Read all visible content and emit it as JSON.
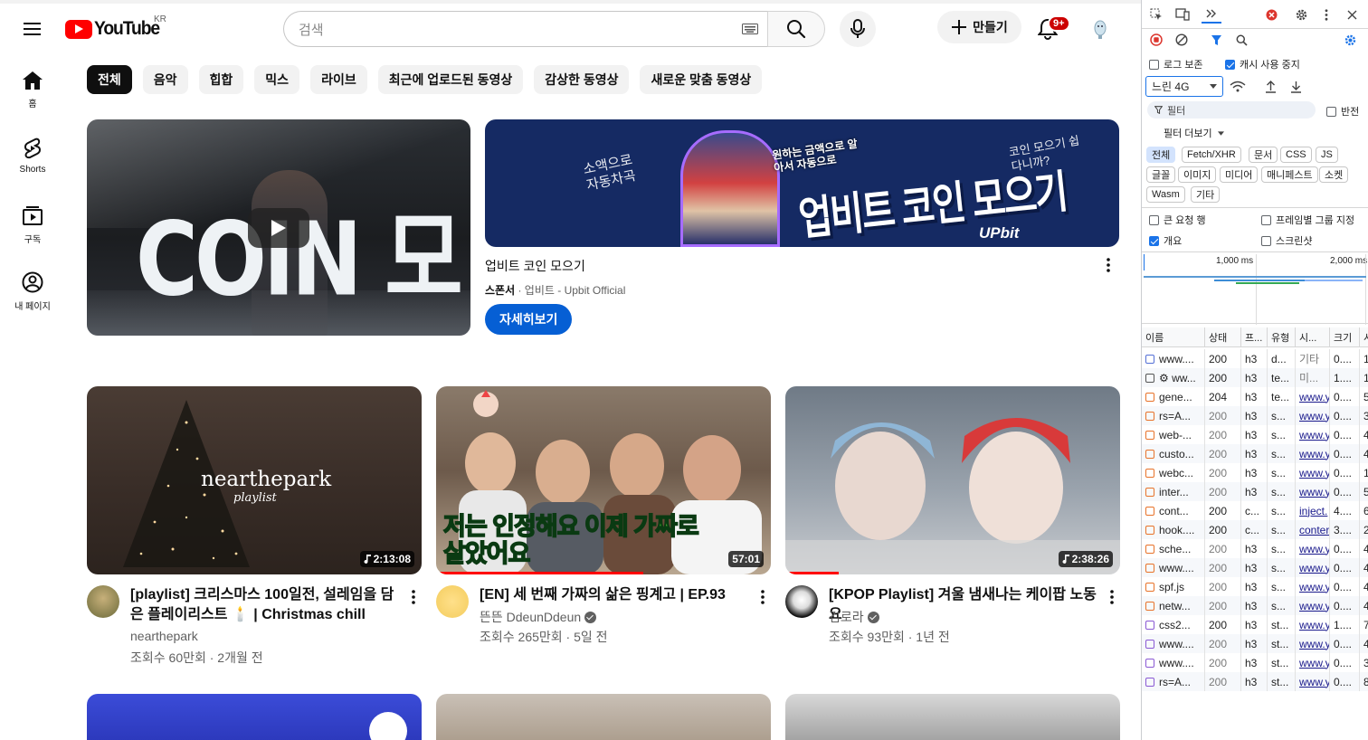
{
  "masthead": {
    "logo_text": "YouTube",
    "country_code": "KR",
    "search_placeholder": "검색",
    "create_label": "만들기",
    "notification_count": "9+"
  },
  "guide": [
    {
      "label": "홈",
      "icon": "home-icon"
    },
    {
      "label": "Shorts",
      "icon": "shorts-icon"
    },
    {
      "label": "구독",
      "icon": "subscriptions-icon"
    },
    {
      "label": "내 페이지",
      "icon": "you-icon"
    }
  ],
  "chips": [
    "전체",
    "음악",
    "힙합",
    "믹스",
    "라이브",
    "최근에 업로드된 동영상",
    "감상한 동영상",
    "새로운 맞춤 동영상"
  ],
  "ad": {
    "video_text": "COIN 모으기",
    "banner_headline": "업비트 코인 모으기",
    "banner_left": "소액으로 자동차곡",
    "banner_sub": "원하는 금액으로 알아서 자동으로",
    "banner_right": "코인 모으기 쉽다니까?",
    "banner_brand": "UPbit",
    "title": "업비트 코인 모으기",
    "sponsor_label": "스폰서",
    "advertiser": "업비트 - Upbit Official",
    "cta": "자세히보기"
  },
  "videos": [
    {
      "title": "[playlist] 크리스마스 100일전, 설레임을 담은 플레이리스트 🕯️ | Christmas chill vibes ...",
      "channel": "nearthepark",
      "verified": false,
      "stats": "조회수 60만회 · 2개월 전",
      "duration": "2:13:08",
      "thumb_text": "nearthepark",
      "thumb_sub": "playlist"
    },
    {
      "title": "[EN] 세 번째 가짜의 삶은 핑계고 | EP.93",
      "channel": "뜬뜬 DdeunDdeun",
      "verified": true,
      "stats": "조회수 265만회 · 5일 전",
      "duration": "57:01",
      "thumb_text": "저는 인정해요 이제 가짜로 살았어요 ",
      "progress": 0.62
    },
    {
      "title": "[KPOP Playlist] 겨울 냄새나는 케이팝 노동요",
      "channel": "김로라",
      "verified": true,
      "stats": "조회수 93만회 · 1년 전",
      "duration": "2:38:26",
      "progress": 0.16
    }
  ],
  "devtools": {
    "preserve_log": "로그 보존",
    "disable_cache": "캐시 사용 중지",
    "throttle": "느린 4G",
    "filter_placeholder": "필터",
    "invert": "반전",
    "more_filters": "필터 더보기",
    "type_filters": [
      "전체",
      "Fetch/XHR",
      "문서",
      "CSS",
      "JS",
      "글꼴",
      "이미지",
      "미디어",
      "매니페스트",
      "소켓",
      "Wasm",
      "기타"
    ],
    "big_request_rows": "큰 요청 행",
    "group_by_frame": "프레임별 그룹 지정",
    "overview": "개요",
    "screenshots": "스크린샷",
    "timeline_ticks": [
      "1,000 ms",
      "2,000 ms"
    ],
    "columns": [
      "이름",
      "상태",
      "프...",
      "유형",
      "시...",
      "크기",
      "시"
    ],
    "rows": [
      {
        "name": "www....",
        "status": "200",
        "proto": "h3",
        "type": "d...",
        "init": "기타",
        "size": "0....",
        "time": "1.",
        "kind": "doc",
        "init_style": "gray"
      },
      {
        "name": "⚙ ww...",
        "status": "200",
        "proto": "h3",
        "type": "te...",
        "init": "미...",
        "size": "1....",
        "time": "1.",
        "kind": "ws",
        "init_style": "gray"
      },
      {
        "name": "gene...",
        "status": "204",
        "proto": "h3",
        "type": "te...",
        "init": "www.y",
        "size": "0....",
        "time": "5",
        "kind": "xhr",
        "init_style": "link"
      },
      {
        "name": "rs=A...",
        "status": "200",
        "proto": "h3",
        "type": "s...",
        "init": "www.y",
        "size": "0....",
        "time": "3",
        "kind": "xhr",
        "init_style": "link",
        "muted": true
      },
      {
        "name": "web-...",
        "status": "200",
        "proto": "h3",
        "type": "s...",
        "init": "www.y",
        "size": "0....",
        "time": "4",
        "kind": "xhr",
        "init_style": "link",
        "muted": true
      },
      {
        "name": "custo...",
        "status": "200",
        "proto": "h3",
        "type": "s...",
        "init": "www.y",
        "size": "0....",
        "time": "4",
        "kind": "xhr",
        "init_style": "link",
        "muted": true
      },
      {
        "name": "webc...",
        "status": "200",
        "proto": "h3",
        "type": "s...",
        "init": "www.y",
        "size": "0....",
        "time": "1.",
        "kind": "xhr",
        "init_style": "link",
        "muted": true
      },
      {
        "name": "inter...",
        "status": "200",
        "proto": "h3",
        "type": "s...",
        "init": "www.y",
        "size": "0....",
        "time": "5",
        "kind": "xhr",
        "init_style": "link",
        "muted": true
      },
      {
        "name": "cont...",
        "status": "200",
        "proto": "c...",
        "type": "s...",
        "init": "inject.",
        "size": "4....",
        "time": "6",
        "kind": "xhr",
        "init_style": "link"
      },
      {
        "name": "hook....",
        "status": "200",
        "proto": "c...",
        "type": "s...",
        "init": "conter",
        "size": "3....",
        "time": "2",
        "kind": "xhr",
        "init_style": "link"
      },
      {
        "name": "sche...",
        "status": "200",
        "proto": "h3",
        "type": "s...",
        "init": "www.y",
        "size": "0....",
        "time": "4",
        "kind": "xhr",
        "init_style": "link",
        "muted": true
      },
      {
        "name": "www....",
        "status": "200",
        "proto": "h3",
        "type": "s...",
        "init": "www.y",
        "size": "0....",
        "time": "4",
        "kind": "xhr",
        "init_style": "link",
        "muted": true
      },
      {
        "name": "spf.js",
        "status": "200",
        "proto": "h3",
        "type": "s...",
        "init": "www.y",
        "size": "0....",
        "time": "4",
        "kind": "xhr",
        "init_style": "link",
        "muted": true
      },
      {
        "name": "netw...",
        "status": "200",
        "proto": "h3",
        "type": "s...",
        "init": "www.y",
        "size": "0....",
        "time": "4",
        "kind": "xhr",
        "init_style": "link",
        "muted": true
      },
      {
        "name": "css2...",
        "status": "200",
        "proto": "h3",
        "type": "st...",
        "init": "www.y",
        "size": "1....",
        "time": "7",
        "kind": "css",
        "init_style": "link"
      },
      {
        "name": "www....",
        "status": "200",
        "proto": "h3",
        "type": "st...",
        "init": "www.y",
        "size": "0....",
        "time": "4",
        "kind": "css",
        "init_style": "link",
        "muted": true
      },
      {
        "name": "www....",
        "status": "200",
        "proto": "h3",
        "type": "st...",
        "init": "www.y",
        "size": "0....",
        "time": "3",
        "kind": "css",
        "init_style": "link",
        "muted": true
      },
      {
        "name": "rs=A...",
        "status": "200",
        "proto": "h3",
        "type": "st...",
        "init": "www.y",
        "size": "0....",
        "time": "8",
        "kind": "css",
        "init_style": "link",
        "muted": true
      }
    ]
  },
  "colors": {
    "brand_red": "#ff0000",
    "cta_blue": "#065fd4",
    "devtools_blue": "#1a73e8"
  }
}
